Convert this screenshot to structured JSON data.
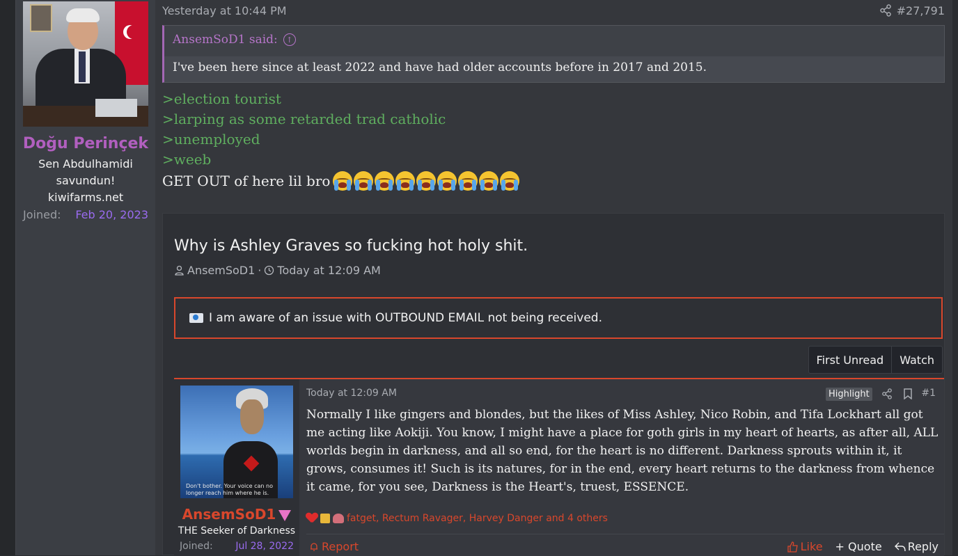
{
  "post": {
    "author": {
      "name": "Doğu Perinçek",
      "title": "Sen Abdulhamidi savundun! kiwifarms.net",
      "joined_label": "Joined:",
      "joined_date": "Feb 20, 2023"
    },
    "date": "Yesterday at 10:44 PM",
    "number": "#27,791",
    "quote": {
      "author": "AnsemSoD1 said:",
      "text": "I've been here since at least 2022 and have had older accounts before in 2017 and 2015."
    },
    "greentext": [
      ">election tourist",
      ">larping as some retarded trad catholic",
      ">unemployed",
      ">weeb"
    ],
    "closing_text": "GET OUT of here lil bro",
    "emoji_count": 9,
    "emoji_name": "loudly-crying-face-icon"
  },
  "embed": {
    "title": "Why is Ashley Graves so fucking hot holy shit.",
    "author": "AnsemSoD1",
    "separator": "·",
    "date": "Today at 12:09 AM",
    "notice": "I am aware of an issue with OUTBOUND EMAIL not being received.",
    "buttons": {
      "first_unread": "First Unread",
      "watch": "Watch"
    },
    "inner_post": {
      "author": {
        "name": "AnsemSoD1",
        "title": "THE Seeker of Darkness",
        "joined_label": "Joined:",
        "joined_date": "Jul 28, 2022",
        "avatar_caption": "Don't bother. Your voice can no longer reach him where he is."
      },
      "date": "Today at 12:09 AM",
      "highlight": "Highlight",
      "number": "#1",
      "body": "Normally I like gingers and blondes, but the likes of Miss Ashley, Nico Robin, and Tifa Lockhart all got me acting like Aokiji. You know, I might have a place for goth girls in my heart of hearts, as after all, ALL worlds begin in darkness, and all so end, for the heart is no different. Darkness sprouts within it, it grows, consumes it! Such is its natures, for in the end, every heart returns to the darkness from whence it came, for you see, Darkness is the Heart's, truest, ESSENCE.",
      "reactions": "fatget, Rectum Ravager, Harvey Danger and 4 others",
      "actions": {
        "report": "Report",
        "like": "Like",
        "quote": "+ Quote",
        "reply": "Reply"
      }
    }
  },
  "colors": {
    "background": "#35373c",
    "accent_red": "#d9472c",
    "username_purple": "#b15fbf",
    "greentext": "#5fae5f",
    "joined_date": "#9a6bf0"
  }
}
